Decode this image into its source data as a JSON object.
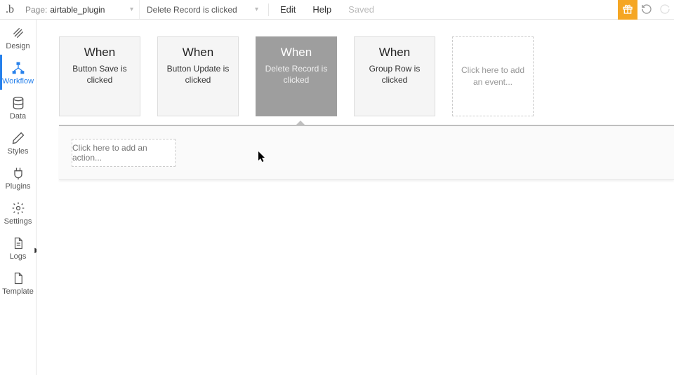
{
  "topbar": {
    "page_label": "Page:",
    "page_value": "airtable_plugin",
    "event_value": "Delete Record is clicked",
    "edit": "Edit",
    "help": "Help",
    "saved": "Saved"
  },
  "sidebar": {
    "items": [
      {
        "label": "Design"
      },
      {
        "label": "Workflow"
      },
      {
        "label": "Data"
      },
      {
        "label": "Styles"
      },
      {
        "label": "Plugins"
      },
      {
        "label": "Settings"
      },
      {
        "label": "Logs"
      },
      {
        "label": "Template"
      }
    ]
  },
  "workflow": {
    "events": [
      {
        "when": "When",
        "desc": "Button Save is clicked",
        "selected": false
      },
      {
        "when": "When",
        "desc": "Button Update is clicked",
        "selected": false
      },
      {
        "when": "When",
        "desc": "Delete Record is clicked",
        "selected": true
      },
      {
        "when": "When",
        "desc": "Group Row is clicked",
        "selected": false
      }
    ],
    "add_event": "Click here to add an event...",
    "add_action": "Click here to add an action..."
  },
  "colors": {
    "accent": "#2680eb",
    "gift": "#f5a623"
  }
}
